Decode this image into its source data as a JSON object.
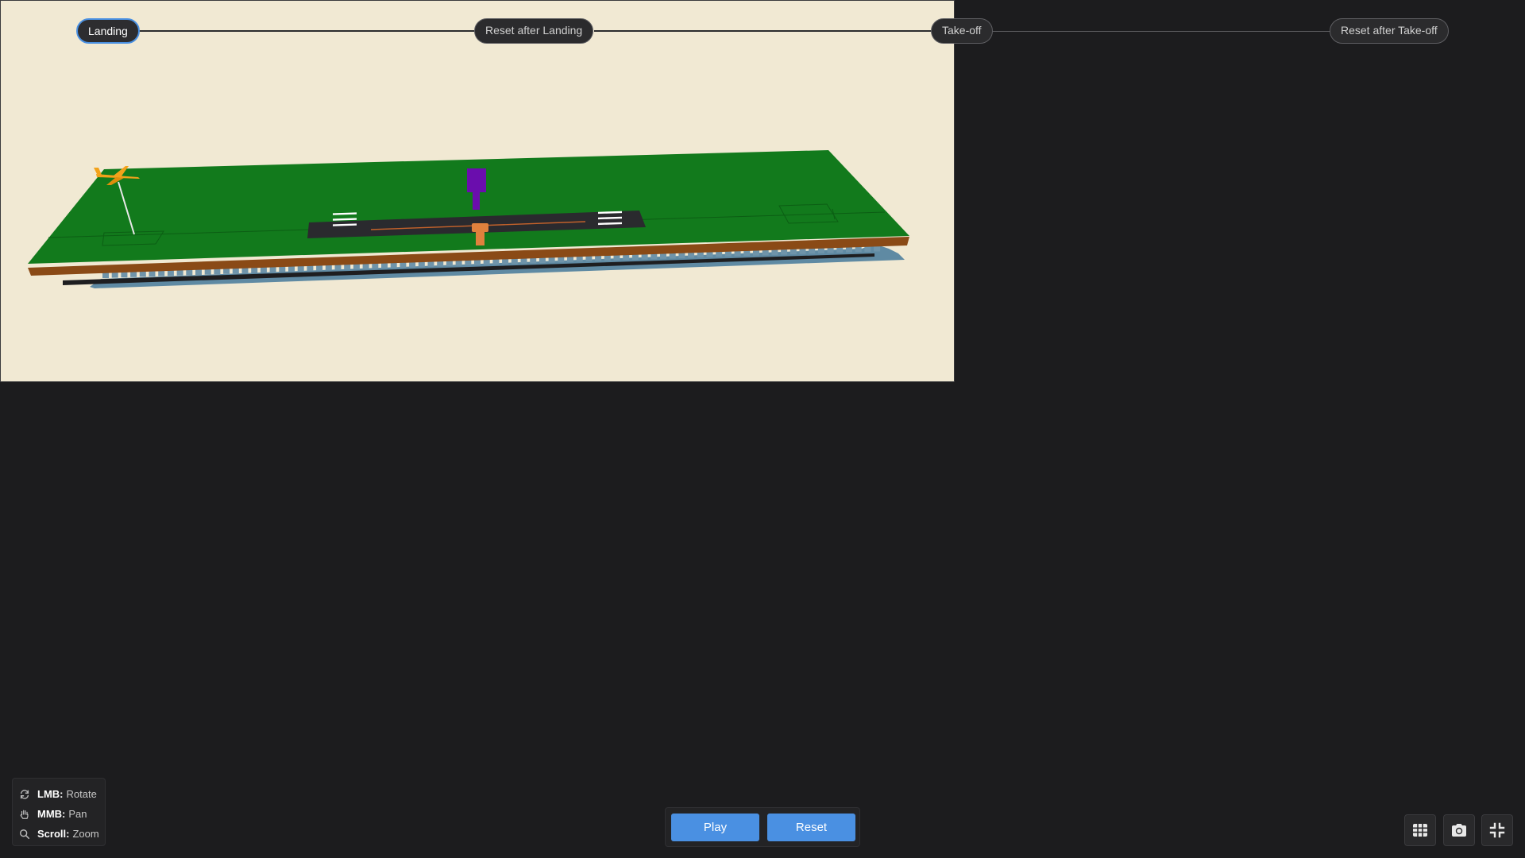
{
  "timeline": {
    "steps": [
      {
        "label": "Landing",
        "active": true
      },
      {
        "label": "Reset after Landing",
        "active": false
      },
      {
        "label": "Take-off",
        "active": false
      },
      {
        "label": "Reset after Take-off",
        "active": false
      }
    ]
  },
  "help": {
    "rotate": {
      "key": "LMB:",
      "action": "Rotate",
      "icon": "rotate-icon"
    },
    "pan": {
      "key": "MMB:",
      "action": "Pan",
      "icon": "hand-icon"
    },
    "zoom": {
      "key": "Scroll:",
      "action": "Zoom",
      "icon": "search-icon"
    }
  },
  "controls": {
    "play_label": "Play",
    "reset_label": "Reset"
  },
  "toolbar": {
    "icons": [
      "grid-icon",
      "camera-icon",
      "collapse-icon"
    ]
  },
  "colors": {
    "accent": "#4a90e2",
    "viewport_bg": "#f1e9d3",
    "ground": "#127a1c",
    "runway": "#2a2a2e",
    "aircraft": "#f2a21b",
    "tower": "#6a0dad"
  }
}
